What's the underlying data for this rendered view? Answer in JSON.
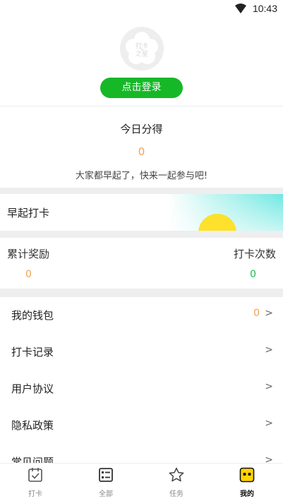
{
  "status_bar": {
    "time": "10:43"
  },
  "profile": {
    "avatar_text": "打卡之星",
    "login_label": "点击登录"
  },
  "today": {
    "title": "今日分得",
    "value": "0",
    "subtitle": "大家都早起了，快来一起参与吧!"
  },
  "banner": {
    "label": "早起打卡"
  },
  "stats": {
    "left": {
      "label": "累计奖励",
      "value": "0"
    },
    "right": {
      "label": "打卡次数",
      "value": "0"
    }
  },
  "menu": {
    "items": [
      {
        "label": "我的钱包",
        "badge": "0",
        "chevron": ">"
      },
      {
        "label": "打卡记录",
        "chevron": ">"
      },
      {
        "label": "用户协议",
        "chevron": ">"
      },
      {
        "label": "隐私政策",
        "chevron": ">"
      },
      {
        "label": "常见问题",
        "chevron": ">"
      }
    ]
  },
  "tabs": [
    {
      "label": "打卡",
      "icon": "calendar-check-icon",
      "active": false
    },
    {
      "label": "全部",
      "icon": "list-icon",
      "active": false
    },
    {
      "label": "任务",
      "icon": "star-icon",
      "active": false
    },
    {
      "label": "我的",
      "icon": "face-icon",
      "active": true
    }
  ],
  "colors": {
    "accent_green": "#16b828",
    "value_orange": "#f0a352",
    "value_green": "#18c04b",
    "sun_yellow": "#fde12a",
    "sky_cyan": "#6fe8e2",
    "tab_active_yellow": "#ffd400"
  }
}
